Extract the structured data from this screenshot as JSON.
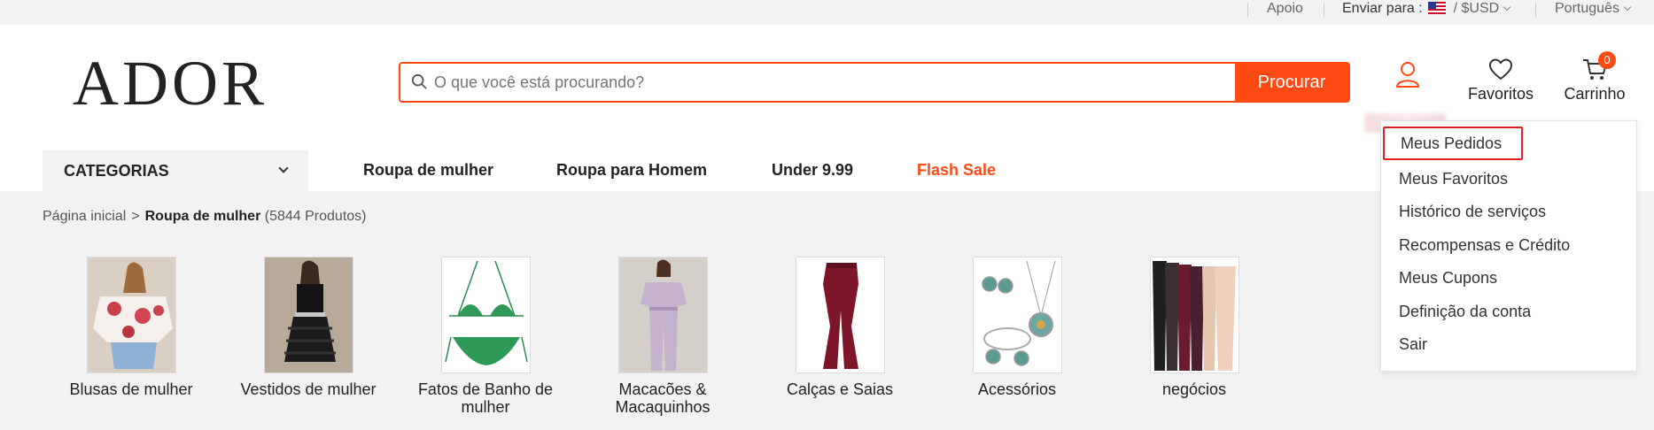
{
  "topbar": {
    "support": "Apoio",
    "ship_to_label": "Enviar para :",
    "currency": "/ $USD",
    "language": "Português"
  },
  "header": {
    "logo": "ADOR",
    "search_placeholder": "O que você está procurando?",
    "search_button": "Procurar",
    "favorites_label": "Favoritos",
    "cart_label": "Carrinho",
    "cart_count": "0"
  },
  "nav": {
    "categories_label": "CATEGORIAS",
    "links": [
      "Roupa de mulher",
      "Roupa para Homem",
      "Under 9.99",
      "Flash Sale"
    ]
  },
  "breadcrumb": {
    "home": "Página inicial",
    "separator": ">",
    "current": "Roupa de mulher",
    "count": "(5844 Produtos)"
  },
  "categories": [
    {
      "label": "Blusas de mulher",
      "icon": "blouse-image"
    },
    {
      "label": "Vestidos de mulher",
      "icon": "dress-image"
    },
    {
      "label": "Fatos de Banho de mulher",
      "icon": "bikini-image"
    },
    {
      "label": "Macacões & Macaquinhos",
      "icon": "jumpsuit-image"
    },
    {
      "label": "Calças e Saias",
      "icon": "pants-image"
    },
    {
      "label": "Acessórios",
      "icon": "jewelry-image"
    },
    {
      "label": "negócios",
      "icon": "leggings-image"
    }
  ],
  "account_menu": {
    "items": [
      "Meus Pedidos",
      "Meus Favoritos",
      "Histórico de serviços",
      "Recompensas e Crédito",
      "Meus Cupons",
      "Definição da conta",
      "Sair"
    ],
    "highlighted_index": 0
  },
  "colors": {
    "accent": "#ff4a14",
    "highlight_border": "#e02020"
  }
}
